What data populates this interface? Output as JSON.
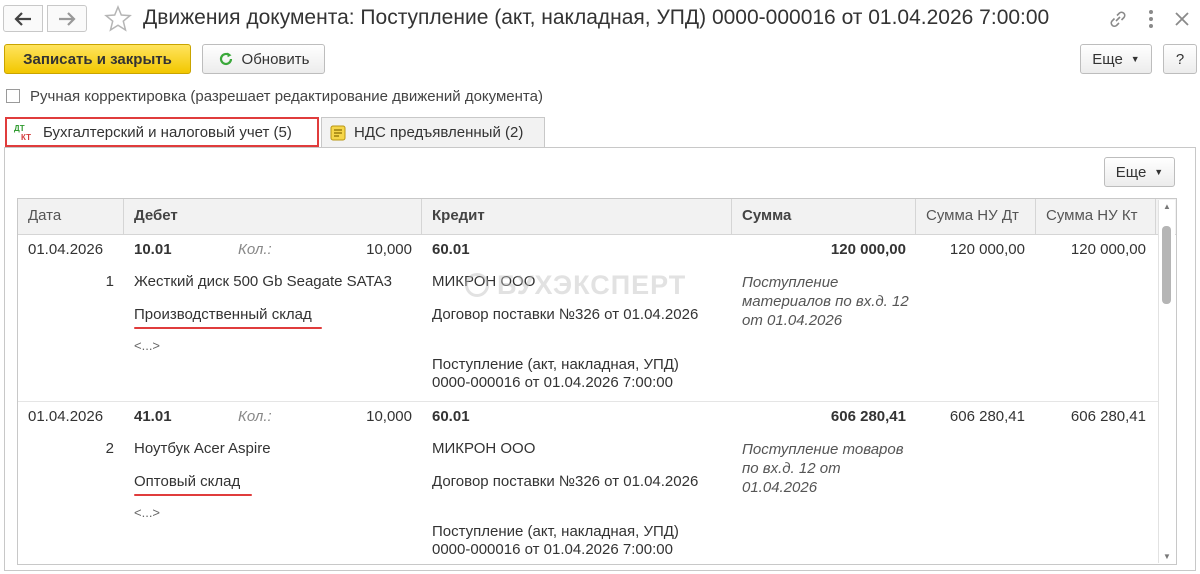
{
  "window": {
    "title": "Движения документа: Поступление (акт, накладная, УПД) 0000-000016 от 01.04.2026 7:00:00"
  },
  "toolbar": {
    "save_close": "Записать и закрыть",
    "refresh": "Обновить",
    "more": "Еще",
    "help": "?"
  },
  "manual_correction": {
    "label": "Ручная корректировка (разрешает редактирование движений документа)",
    "checked": false
  },
  "tabs": [
    {
      "label": "Бухгалтерский и налоговый учет (5)",
      "icon": "dt-kt-icon",
      "active": true
    },
    {
      "label": "НДС предъявленный (2)",
      "icon": "register-icon",
      "active": false
    }
  ],
  "table": {
    "more": "Еще",
    "columns": [
      "Дата",
      "Дебет",
      "Кредит",
      "Сумма",
      "Сумма НУ Дт",
      "Сумма НУ Кт"
    ],
    "qty_label": "Кол.:",
    "rows": [
      {
        "date": "01.04.2026",
        "num": "1",
        "debit_account": "10.01",
        "qty": "10,000",
        "debit_sub1": "Жесткий диск 500 Gb Seagate SATA3",
        "debit_sub2": "Производственный склад",
        "debit_sub3": "<...>",
        "credit_account": "60.01",
        "credit_sub1": "МИКРОН ООО",
        "credit_sub2": "Договор поставки №326 от 01.04.2026",
        "credit_sub3": "Поступление (акт, накладная, УПД) 0000-000016 от 01.04.2026 7:00:00",
        "sum": "120 000,00",
        "content": "Поступление материалов по вх.д. 12 от 01.04.2026",
        "sum_nu_dt": "120 000,00",
        "sum_nu_kt": "120 000,00"
      },
      {
        "date": "01.04.2026",
        "num": "2",
        "debit_account": "41.01",
        "qty": "10,000",
        "debit_sub1": "Ноутбук Acer Aspire",
        "debit_sub2": "Оптовый склад",
        "debit_sub3": "<...>",
        "credit_account": "60.01",
        "credit_sub1": "МИКРОН ООО",
        "credit_sub2": "Договор поставки №326 от 01.04.2026",
        "credit_sub3": "Поступление (акт, накладная, УПД) 0000-000016 от 01.04.2026 7:00:00",
        "sum": "606 280,41",
        "content": "Поступление товаров по вх.д. 12 от 01.04.2026",
        "sum_nu_dt": "606 280,41",
        "sum_nu_kt": "606 280,41"
      }
    ]
  },
  "watermark": "БУХЭКСПЕРТ",
  "colors": {
    "primary_button": "#f5cf1a",
    "highlight_red": "#e03c3c",
    "refresh_green": "#3aa83a"
  }
}
